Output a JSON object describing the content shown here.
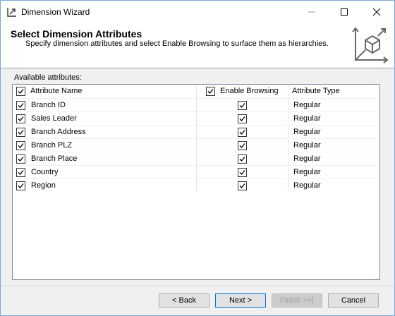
{
  "window": {
    "title": "Dimension Wizard"
  },
  "banner": {
    "title": "Select Dimension Attributes",
    "subtitle": "Specify dimension attributes and select Enable Browsing to surface them as hierarchies."
  },
  "attributes_label": "Available attributes:",
  "grid": {
    "columns": {
      "name": "Attribute Name",
      "browse": "Enable Browsing",
      "type": "Attribute Type"
    },
    "header_checks": {
      "name": true,
      "browse": true
    },
    "rows": [
      {
        "name": "Branch ID",
        "selected": true,
        "browse": true,
        "type": "Regular"
      },
      {
        "name": "Sales Leader",
        "selected": true,
        "browse": true,
        "type": "Regular"
      },
      {
        "name": "Branch Address",
        "selected": true,
        "browse": true,
        "type": "Regular"
      },
      {
        "name": "Branch PLZ",
        "selected": true,
        "browse": true,
        "type": "Regular"
      },
      {
        "name": "Branch Place",
        "selected": true,
        "browse": true,
        "type": "Regular"
      },
      {
        "name": "Country",
        "selected": true,
        "browse": true,
        "type": "Regular"
      },
      {
        "name": "Region",
        "selected": true,
        "browse": true,
        "type": "Regular"
      }
    ]
  },
  "buttons": {
    "back": "< Back",
    "next": "Next >",
    "finish": "Finish >>|",
    "cancel": "Cancel"
  },
  "colors": {
    "accent": "#0078d7",
    "grid_border": "#828790"
  }
}
